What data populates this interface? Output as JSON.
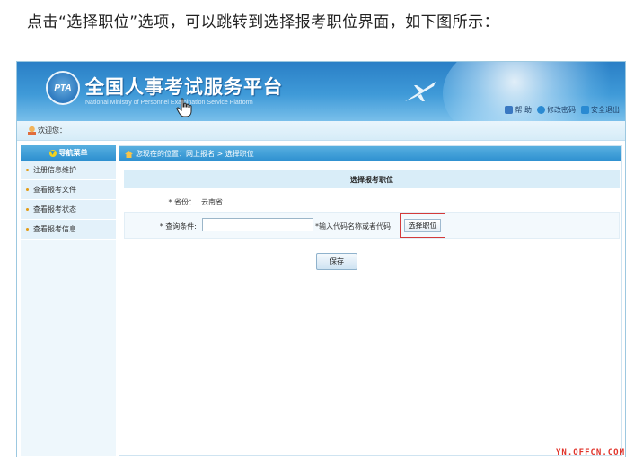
{
  "intro_text": "点击“选择职位”选项，可以跳转到选择报考职位界面，如下图所示：",
  "header": {
    "title": "全国人事考试服务平台",
    "subtitle": "National Ministry of Personnel Examination Service Platform",
    "logo_text": "PTA",
    "links": [
      {
        "label": "帮 助",
        "icon": "lock-icon",
        "color": "#3a78c2"
      },
      {
        "label": "修改密码",
        "icon": "question-icon",
        "color": "#2a8ad2"
      },
      {
        "label": "安全退出",
        "icon": "exit-icon",
        "color": "#2a8ad2"
      }
    ]
  },
  "welcome": "欢迎您：",
  "sidebar": {
    "title": "导航菜单",
    "items": [
      {
        "label": "注册信息维护"
      },
      {
        "label": "查看报考文件"
      },
      {
        "label": "查看报考状态"
      },
      {
        "label": "查看报考信息"
      }
    ]
  },
  "breadcrumb": "您现在的位置：网上报名 > 选择职位",
  "panel": {
    "title": "选择报考职位",
    "province_label": "* 省份：",
    "province_value": "云南省",
    "query_label": "* 查询条件:",
    "query_value": "",
    "query_hint": "*输入代码名称或者代码",
    "select_button": "选择职位",
    "save_button": "保存"
  },
  "watermark": "YN.OFFCN.COM",
  "colors": {
    "header_blue": "#2a7fc6",
    "nav_blue": "#2d8fd0",
    "highlight_red": "#d43a3a",
    "watermark_red": "#e0332a"
  }
}
